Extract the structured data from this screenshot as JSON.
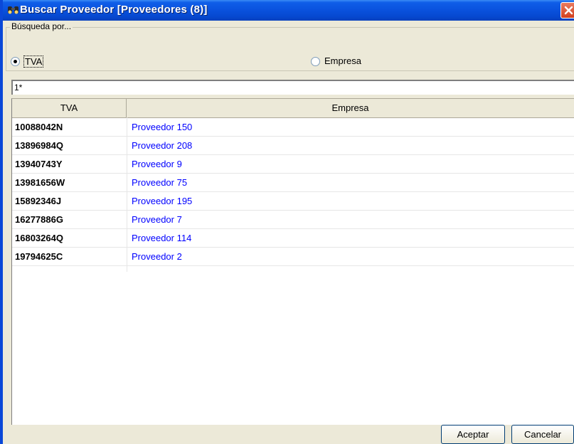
{
  "window": {
    "title": "Buscar Proveedor [Proveedores (8)]",
    "title_icon": "binoculars-icon",
    "close_icon": "close-icon",
    "accent": "#0a53df"
  },
  "search_by": {
    "legend": "Búsqueda por...",
    "options": [
      {
        "label": "TVA",
        "selected": true
      },
      {
        "label": "Empresa",
        "selected": false
      }
    ]
  },
  "search": {
    "value": "1*"
  },
  "table": {
    "columns": [
      "TVA",
      "Empresa"
    ],
    "rows": [
      {
        "tva": "10088042N",
        "empresa": "Proveedor 150"
      },
      {
        "tva": "13896984Q",
        "empresa": "Proveedor 208"
      },
      {
        "tva": "13940743Y",
        "empresa": "Proveedor 9"
      },
      {
        "tva": "13981656W",
        "empresa": "Proveedor 75"
      },
      {
        "tva": "15892346J",
        "empresa": "Proveedor 195"
      },
      {
        "tva": "16277886G",
        "empresa": "Proveedor 7"
      },
      {
        "tva": "16803264Q",
        "empresa": "Proveedor 114"
      },
      {
        "tva": "19794625C",
        "empresa": "Proveedor 2"
      }
    ]
  },
  "buttons": {
    "accept": "Aceptar",
    "cancel": "Cancelar"
  }
}
